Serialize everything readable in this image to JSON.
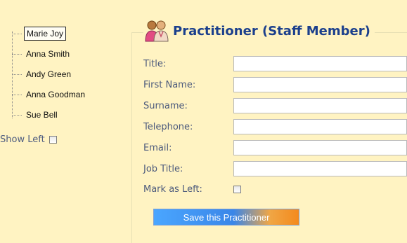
{
  "tree": {
    "items": [
      {
        "label": "Marie Joy",
        "selected": true
      },
      {
        "label": "Anna Smith",
        "selected": false
      },
      {
        "label": "Andy Green",
        "selected": false
      },
      {
        "label": "Anna Goodman",
        "selected": false
      },
      {
        "label": "Sue Bell",
        "selected": false
      }
    ],
    "show_left_label": "Show Left",
    "show_left_checked": false
  },
  "form": {
    "title": "Practitioner (Staff Member)",
    "icon": "staff-people-icon",
    "fields": [
      {
        "label": "Title:",
        "value": ""
      },
      {
        "label": "First Name:",
        "value": ""
      },
      {
        "label": "Surname:",
        "value": ""
      },
      {
        "label": "Telephone:",
        "value": ""
      },
      {
        "label": "Email:",
        "value": ""
      },
      {
        "label": "Job Title:",
        "value": ""
      }
    ],
    "mark_left_label": "Mark as Left:",
    "mark_left_checked": false,
    "save_label": "Save this Practitioner"
  },
  "colors": {
    "background": "#fff3c2",
    "title": "#1b3f8c",
    "label": "#4c5a7c"
  }
}
